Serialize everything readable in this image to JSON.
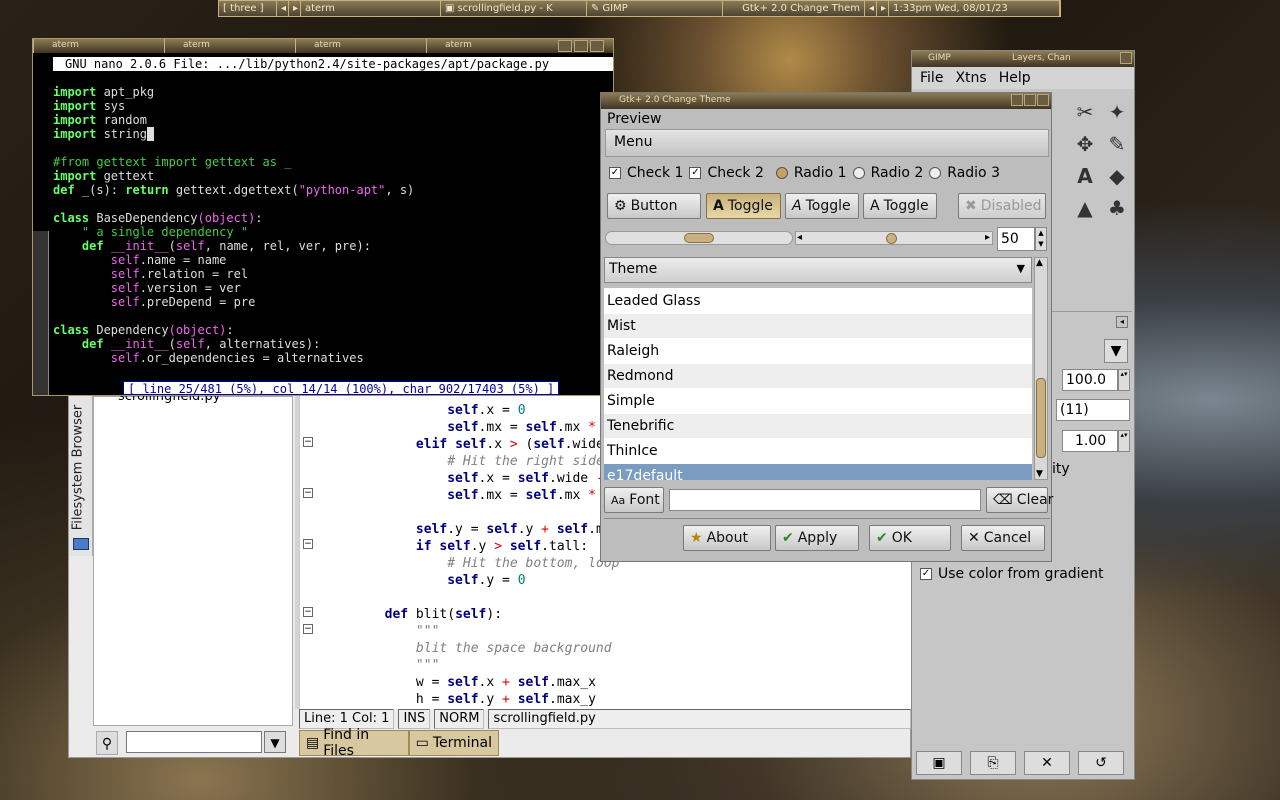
{
  "taskbar": {
    "items": [
      "[ three ]",
      "aterm",
      "scrollingfield.py - K",
      "GIMP",
      "Gtk+ 2.0 Change Them",
      "1:33pm Wed, 08/01/23"
    ]
  },
  "aterm": {
    "tabs": [
      "aterm",
      "aterm",
      "aterm",
      "aterm"
    ],
    "nano_header": "GNU nano 2.0.6 File: .../lib/python2.4/site-packages/apt/package.py",
    "status": "[ line 25/481 (5%), col 14/14 (100%), char 902/17403 (5%) ]"
  },
  "geany": {
    "sidebar_tab": "Filesystem Browser",
    "file_partial": "scrollingfield.py",
    "status": {
      "pos": "Line: 1 Col: 1",
      "ins": "INS",
      "norm": "NORM",
      "file": "scrollingfield.py"
    },
    "bottom_tabs": [
      "Find in Files",
      "Terminal"
    ]
  },
  "gimp": {
    "title": "GIMP",
    "title2": "Layers, Chan",
    "menu": [
      "File",
      "Xtns",
      "Help"
    ],
    "opacity": "100.0",
    "brush": "(11)",
    "scale": "1.00",
    "gradient_label": "Use color from gradient",
    "partial": "ity"
  },
  "theme": {
    "title": "Gtk+ 2.0 Change Theme",
    "preview": "Preview",
    "menu": "Menu",
    "check1": "Check 1",
    "check2": "Check 2",
    "radio1": "Radio 1",
    "radio2": "Radio 2",
    "radio3": "Radio 3",
    "button": "Button",
    "toggle": "Toggle",
    "disabled": "Disabled",
    "spin": "50",
    "header": "Theme",
    "themes": [
      "Leaded Glass",
      "Mist",
      "Raleigh",
      "Redmond",
      "Simple",
      "Tenebrific",
      "ThinIce",
      "e17default"
    ],
    "selected": "e17default",
    "font": "Font",
    "clear": "Clear",
    "about": "About",
    "apply": "Apply",
    "ok": "OK",
    "cancel": "Cancel"
  }
}
